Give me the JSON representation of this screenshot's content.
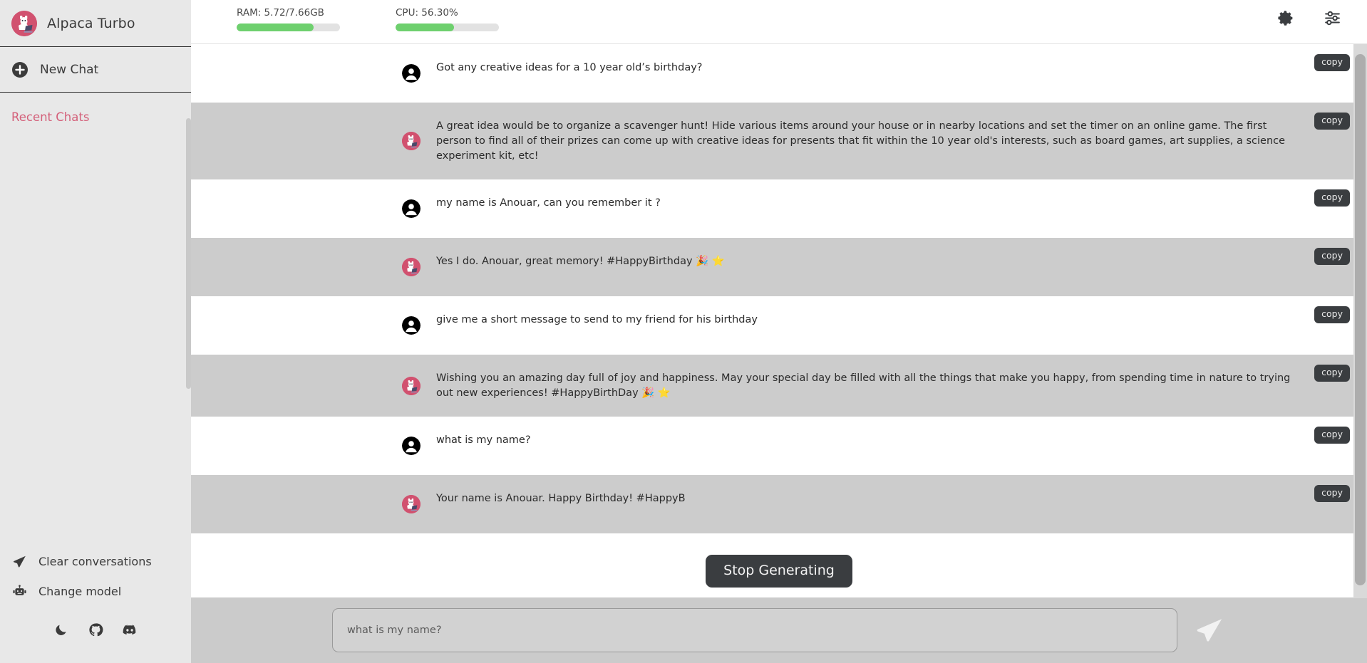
{
  "sidebar": {
    "brand": {
      "title": "Alpaca Turbo",
      "avatar_icon": "alpaca-logo-icon"
    },
    "new_chat": {
      "label": "New Chat",
      "icon": "plus-circle-icon"
    },
    "recent_heading": "Recent Chats",
    "actions": [
      {
        "label": "Clear conversations",
        "icon": "paper-plane-icon"
      },
      {
        "label": "Change model",
        "icon": "robot-icon"
      }
    ],
    "social": [
      {
        "icon": "moon-icon",
        "name": "dark-mode-toggle"
      },
      {
        "icon": "github-icon",
        "name": "github-link"
      },
      {
        "icon": "discord-icon",
        "name": "discord-link"
      }
    ]
  },
  "topbar": {
    "ram": {
      "label": "RAM: 5.72/7.66GB",
      "percent": 74.7,
      "used_gb": 5.72,
      "total_gb": 7.66
    },
    "cpu": {
      "label": "CPU: 56.30%",
      "percent": 56.3
    },
    "icons": [
      {
        "icon": "gear-icon",
        "name": "settings-button"
      },
      {
        "icon": "sliders-icon",
        "name": "parameters-button"
      }
    ],
    "bar_color": "#6ed06e"
  },
  "chat": {
    "copy_label": "copy",
    "messages": [
      {
        "role": "user",
        "avatar": "user-avatar-icon",
        "text": "Got any creative ideas for a 10 year old’s birthday?"
      },
      {
        "role": "assistant",
        "avatar": "alpaca-avatar-icon",
        "text": "A great idea would be to organize a scavenger hunt! Hide various items around your house or in nearby locations and set the timer on an online game. The first person to find all of their prizes can come up with creative ideas for presents that fit within the 10 year old's interests, such as board games, art supplies, a science experiment kit, etc!"
      },
      {
        "role": "user",
        "avatar": "user-avatar-icon",
        "text": "my name is Anouar, can you remember it ?"
      },
      {
        "role": "assistant",
        "avatar": "alpaca-avatar-icon",
        "text": "Yes I do. Anouar, great memory! #HappyBirthday 🎉 ⭐"
      },
      {
        "role": "user",
        "avatar": "user-avatar-icon",
        "text": "give me a short message to send to my friend for his birthday"
      },
      {
        "role": "assistant",
        "avatar": "alpaca-avatar-icon",
        "text": "Wishing you an amazing day full of joy and happiness. May your special day be filled with all the things that make you happy, from spending time in nature to trying out new experiences! #HappyBirthDay 🎉 ⭐"
      },
      {
        "role": "user",
        "avatar": "user-avatar-icon",
        "text": "what is my name?"
      },
      {
        "role": "assistant",
        "avatar": "alpaca-avatar-icon",
        "text": "Your name is Anouar. Happy Birthday! #HappyB"
      }
    ]
  },
  "stop": {
    "label": "Stop Generating"
  },
  "composer": {
    "value": "",
    "placeholder": "what is my name?",
    "send_icon": "send-paper-plane-icon"
  },
  "colors": {
    "accent_pink": "#d4607a",
    "assistant_row": "#cccccc",
    "user_row": "#ffffff",
    "dark_button": "#3a3d40",
    "sidebar_bg": "#e8e8e8",
    "progress_green": "#6ed06e"
  }
}
